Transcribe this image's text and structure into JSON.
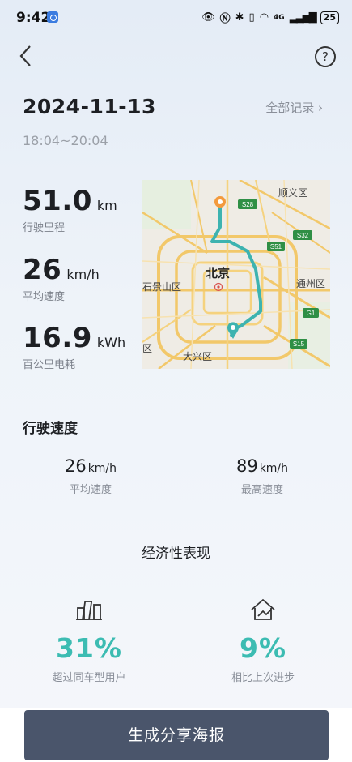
{
  "status_bar": {
    "time": "9:42",
    "battery": "25",
    "network": "4G"
  },
  "trip": {
    "date": "2024-11-13",
    "all_records_label": "全部记录",
    "time_range": "18:04~20:04"
  },
  "metrics": [
    {
      "value": "51.0",
      "unit": "km",
      "label": "行驶里程"
    },
    {
      "value": "26",
      "unit": "km/h",
      "label": "平均速度"
    },
    {
      "value": "16.9",
      "unit": "kWh",
      "label": "百公里电耗"
    }
  ],
  "map": {
    "city_label": "北京",
    "districts": [
      "顺义区",
      "石景山区",
      "通州区",
      "大兴区",
      "区"
    ],
    "highway_labels": [
      "S28",
      "S51",
      "S32",
      "G1",
      "S15"
    ],
    "route_color": "#3db3b0",
    "start_marker_color": "#f39a3d",
    "end_marker_color": "#3db3b0"
  },
  "speed_section": {
    "title": "行驶速度",
    "avg": {
      "value": "26",
      "unit": "km/h",
      "label": "平均速度"
    },
    "max": {
      "value": "89",
      "unit": "km/h",
      "label": "最高速度"
    }
  },
  "economy": {
    "title": "经济性表现",
    "items": [
      {
        "icon": "bar-chart-icon",
        "value": "31%",
        "label": "超过同车型用户"
      },
      {
        "icon": "progress-house-icon",
        "value": "9%",
        "label": "相比上次进步"
      }
    ],
    "accent_color": "#3cbcb2"
  },
  "share_button_label": "生成分享海报"
}
